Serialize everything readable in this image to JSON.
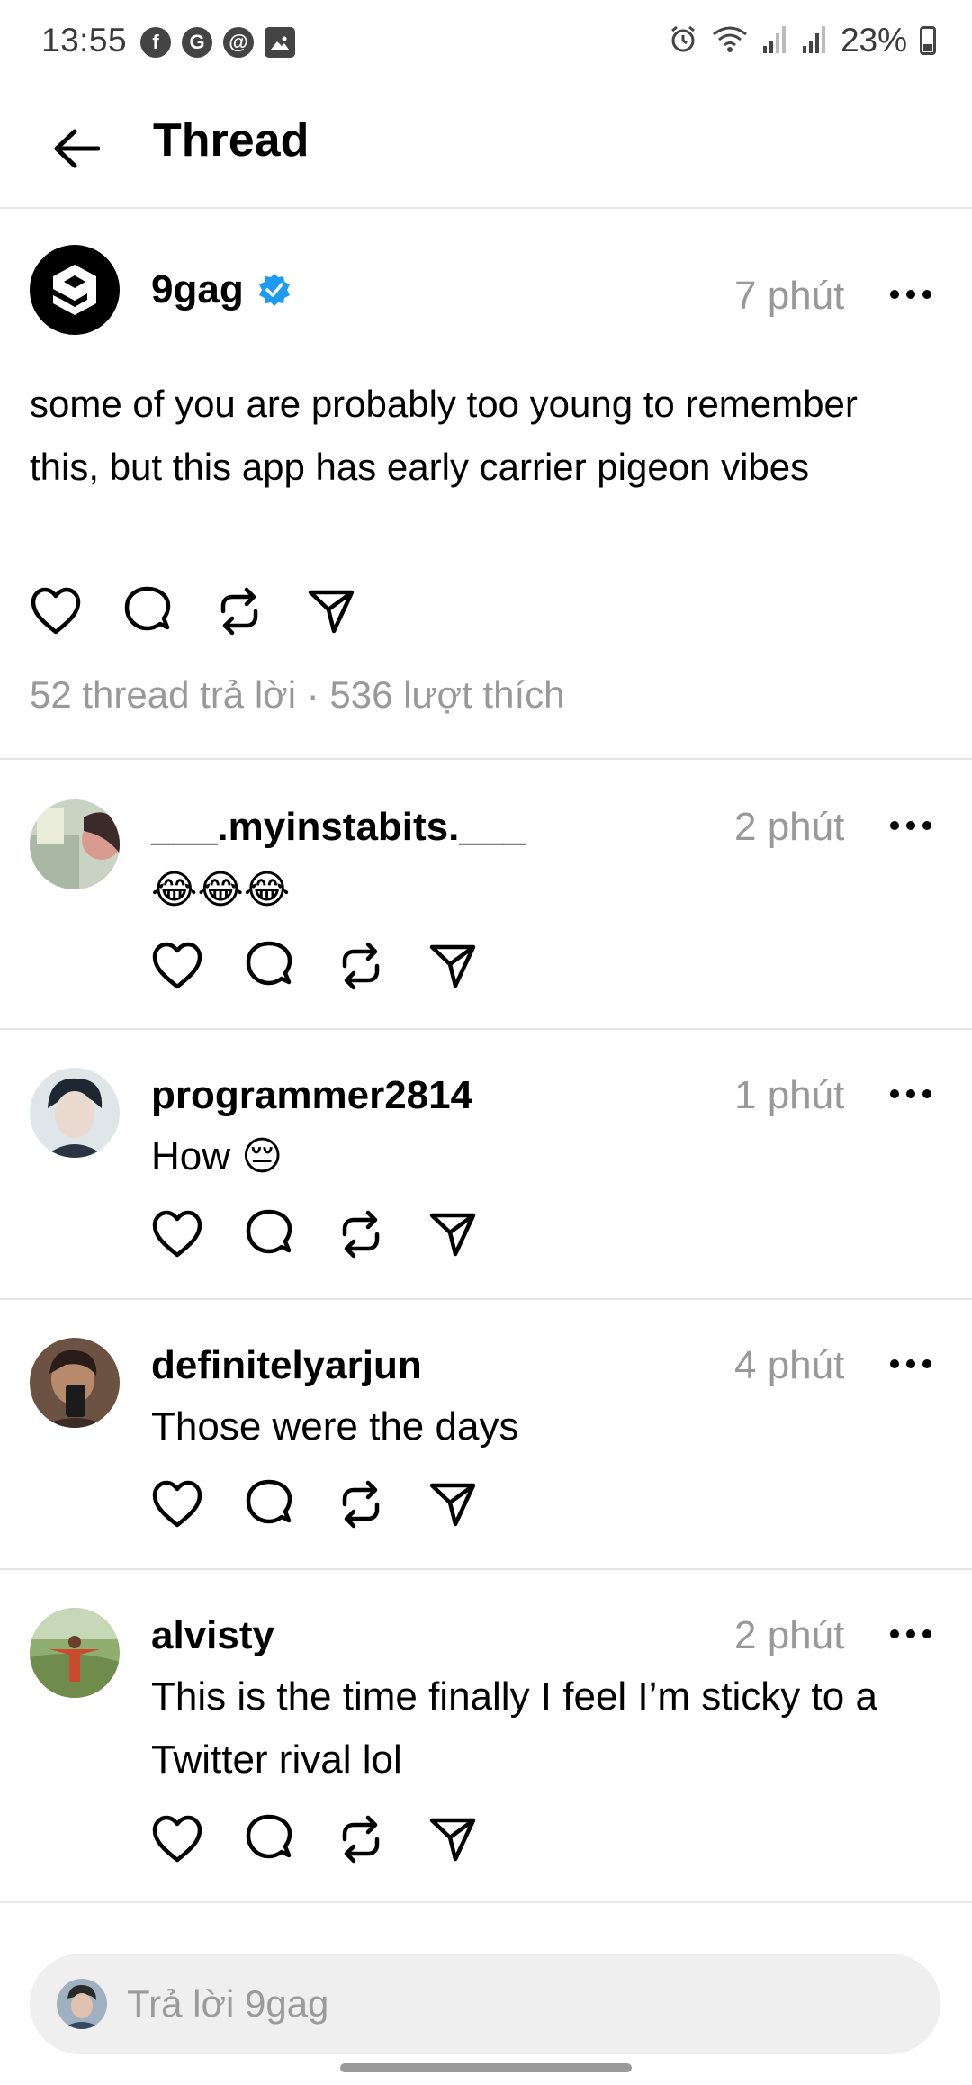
{
  "status_bar": {
    "time": "13:55",
    "battery": "23%",
    "app_icons": [
      "facebook-icon",
      "google-icon",
      "threads-icon",
      "gallery-icon"
    ]
  },
  "header": {
    "title": "Thread"
  },
  "main_post": {
    "username": "9gag",
    "verified": true,
    "time": "7 phút",
    "text": "some of you are probably too young to remember this, but this app has early carrier pigeon vibes",
    "stats": "52 thread trả lời · 536 lượt thích"
  },
  "replies": [
    {
      "username": "___.myinstabits.___",
      "time": "2 phút",
      "text": "😂😂😂"
    },
    {
      "username": "programmer2814",
      "time": "1 phút",
      "text": "How 😔"
    },
    {
      "username": "definitelyarjun",
      "time": "4 phút",
      "text": "Those were the days"
    },
    {
      "username": "alvisty",
      "time": "2 phút",
      "text": "This is the time finally I feel I’m sticky to a Twitter rival lol"
    }
  ],
  "reply_bar": {
    "placeholder": "Trả lời 9gag"
  },
  "colors": {
    "verified_blue": "#1d9bf0",
    "secondary_text": "#999999",
    "divider": "#e6e6e6"
  }
}
